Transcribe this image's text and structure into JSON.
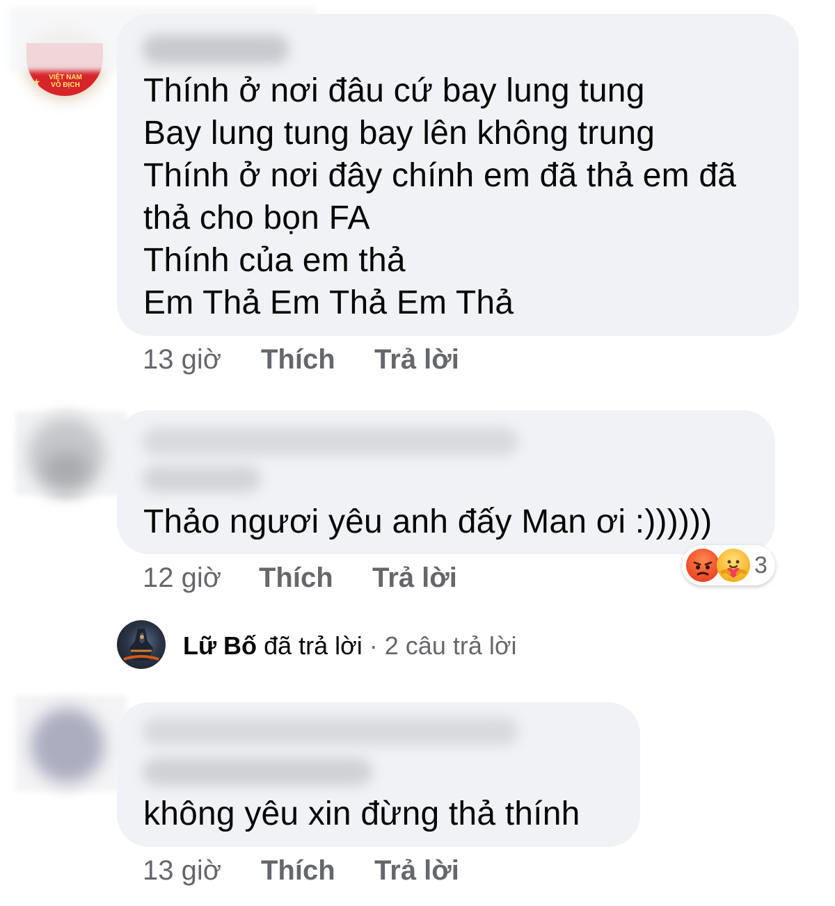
{
  "comments": [
    {
      "avatar_badge": [
        "VIỆT NAM",
        "VÔ ĐỊCH"
      ],
      "lines": [
        "Thính ở nơi đâu cứ bay lung tung",
        "Bay lung tung bay lên không trung",
        "Thính ở nơi đây chính em đã thả em đã",
        "thả cho bọn FA",
        "Thính của em thả",
        "Em Thả Em Thả Em Thả"
      ],
      "time": "13 giờ",
      "like_label": "Thích",
      "reply_label": "Trả lời"
    },
    {
      "lines": [
        "Thảo ngươi yêu anh đấy Man ơi :))))))"
      ],
      "time": "12 giờ",
      "like_label": "Thích",
      "reply_label": "Trả lời",
      "reactions": {
        "icons": [
          "angry-icon",
          "care-icon"
        ],
        "count": "3"
      },
      "replies_summary": {
        "name": "Lữ Bố",
        "verb": "đã trả lời",
        "separator": "·",
        "count_text": "2 câu trả lời"
      }
    },
    {
      "lines": [
        "không yêu xin đừng thả thính"
      ],
      "time": "13 giờ",
      "like_label": "Thích",
      "reply_label": "Trả lời"
    }
  ],
  "colors": {
    "bubble": "#f0f2f5",
    "text": "#050505",
    "meta": "#65676b",
    "angry": "#f0502e",
    "care": "#f7b125"
  }
}
